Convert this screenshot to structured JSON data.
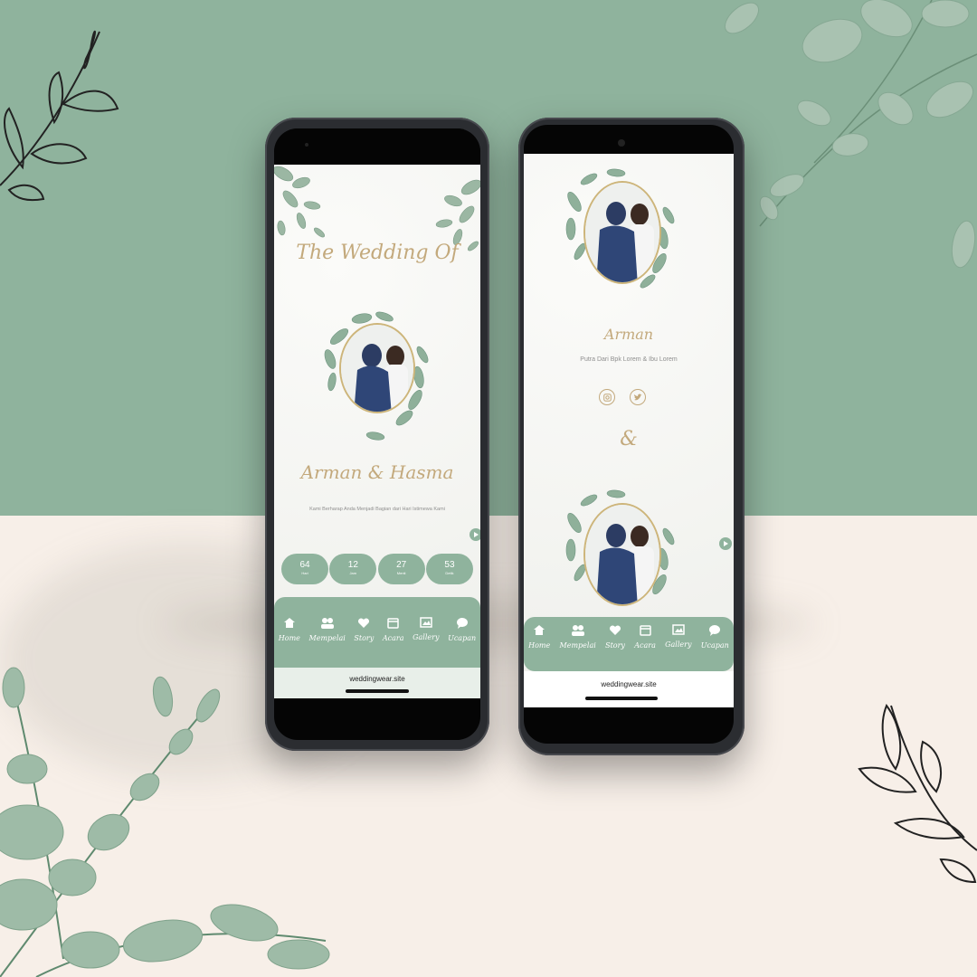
{
  "colors": {
    "sage": "#8fb39d",
    "cream": "#f7efe8",
    "gold": "#c3a97c",
    "phone_frame": "#2b2d31"
  },
  "left_phone": {
    "heading": "The Wedding Of",
    "couple_names": "Arman & Hasma",
    "tagline": "Kami Berharap Anda Menjadi Bagian dari Hari Istimewa Kami",
    "countdown": [
      {
        "value": "64",
        "unit": "Hari"
      },
      {
        "value": "12",
        "unit": "Jam"
      },
      {
        "value": "27",
        "unit": "Menit"
      },
      {
        "value": "53",
        "unit": "Detik"
      }
    ],
    "url": "weddingwear.site",
    "play_icon": "play-icon"
  },
  "right_phone": {
    "groom_name": "Arman",
    "groom_parents": "Putra Dari Bpk Lorem & Ibu Lorem",
    "ampersand": "&",
    "social_icons": [
      "instagram-icon",
      "twitter-icon"
    ],
    "url": "weddingwear.site",
    "play_icon": "play-icon"
  },
  "nav": [
    {
      "label": "Home",
      "icon": "home-icon"
    },
    {
      "label": "Mempelai",
      "icon": "people-icon"
    },
    {
      "label": "Story",
      "icon": "heart-icon"
    },
    {
      "label": "Acara",
      "icon": "calendar-icon"
    },
    {
      "label": "Gallery",
      "icon": "image-icon"
    },
    {
      "label": "Ucapan",
      "icon": "chat-icon"
    }
  ]
}
